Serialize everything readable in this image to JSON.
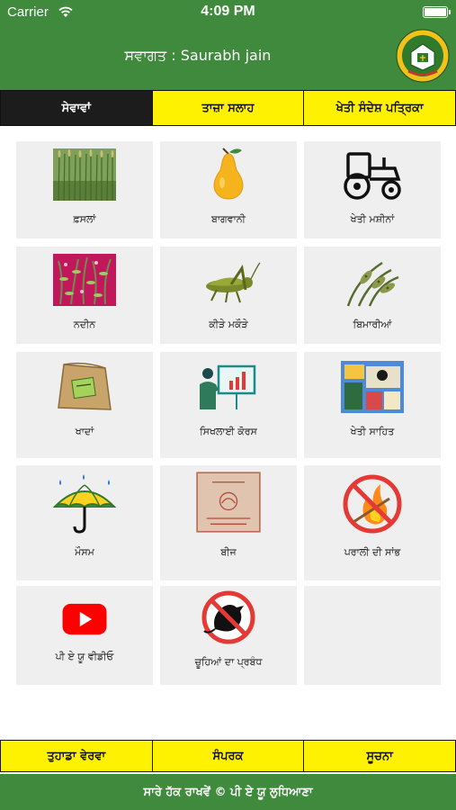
{
  "status_bar": {
    "carrier": "Carrier",
    "time": "4:09 PM",
    "wifi_icon": "wifi-icon",
    "battery_icon": "battery-icon"
  },
  "header": {
    "welcome": "ਸਵਾਗਤ : Saurabh jain",
    "logo_icon": "university-emblem-icon",
    "color": "#3f8a3d"
  },
  "tabs": [
    {
      "label": "ਸੇਵਾਵਾਂ",
      "active": true
    },
    {
      "label": "ਤਾਜ਼ਾ ਸਲਾਹ",
      "active": false
    },
    {
      "label": "ਖੇਤੀ ਸੰਦੇਸ਼ ਪਤ੍ਰਿਕਾ",
      "active": false
    }
  ],
  "tab_colors": {
    "active_bg": "#1c1c1c",
    "inactive_bg": "#fff200"
  },
  "services": [
    {
      "label": "ਫ਼ਸਲਾਂ",
      "icon": "crop-field-icon"
    },
    {
      "label": "ਬਾਗਵਾਨੀ",
      "icon": "pear-fruit-icon"
    },
    {
      "label": "ਖੇਤੀ ਮਸ਼ੀਨਾਂ",
      "icon": "tractor-icon"
    },
    {
      "label": "ਨਦੀਨ",
      "icon": "weeds-icon"
    },
    {
      "label": "ਕੀੜੇ ਮਕੌੜੇ",
      "icon": "grasshopper-icon"
    },
    {
      "label": "ਬਿਮਾਰੀਆਂ",
      "icon": "diseased-plant-icon"
    },
    {
      "label": "ਖਾਦਾਂ",
      "icon": "fertilizer-bag-icon"
    },
    {
      "label": "ਸਿਖਲਾਈ ਕੋਰਸ",
      "icon": "training-presentation-icon"
    },
    {
      "label": "ਖੇਤੀ ਸਾਹਿਤ",
      "icon": "farm-literature-icon"
    },
    {
      "label": "ਮੌਸਮ",
      "icon": "umbrella-rain-icon"
    },
    {
      "label": "ਬੀਜ",
      "icon": "seed-bag-icon"
    },
    {
      "label": "ਪਰਾਲੀ ਦੀ ਸਾਂਭ",
      "icon": "no-stubble-burning-icon"
    },
    {
      "label": "ਪੀ ਏ ਯੂ ਵੀਡੀਓ",
      "icon": "youtube-icon"
    },
    {
      "label": "ਚੂਹਿਆਂ ਦਾ ਪ੍ਰਬੰਧ",
      "icon": "no-rat-icon"
    }
  ],
  "bottom_tabs": [
    {
      "label": "ਤੁਹਾਡਾ ਵੇਰਵਾ"
    },
    {
      "label": "ਸੰਪਰਕ"
    },
    {
      "label": "ਸੂਚਨਾ"
    }
  ],
  "footer": {
    "text": "ਸਾਰੇ ਹੱਕ ਰਾਖਵੇਂ © ਪੀ ਏ ਯੂ ਲੁਧਿਆਣਾ"
  }
}
